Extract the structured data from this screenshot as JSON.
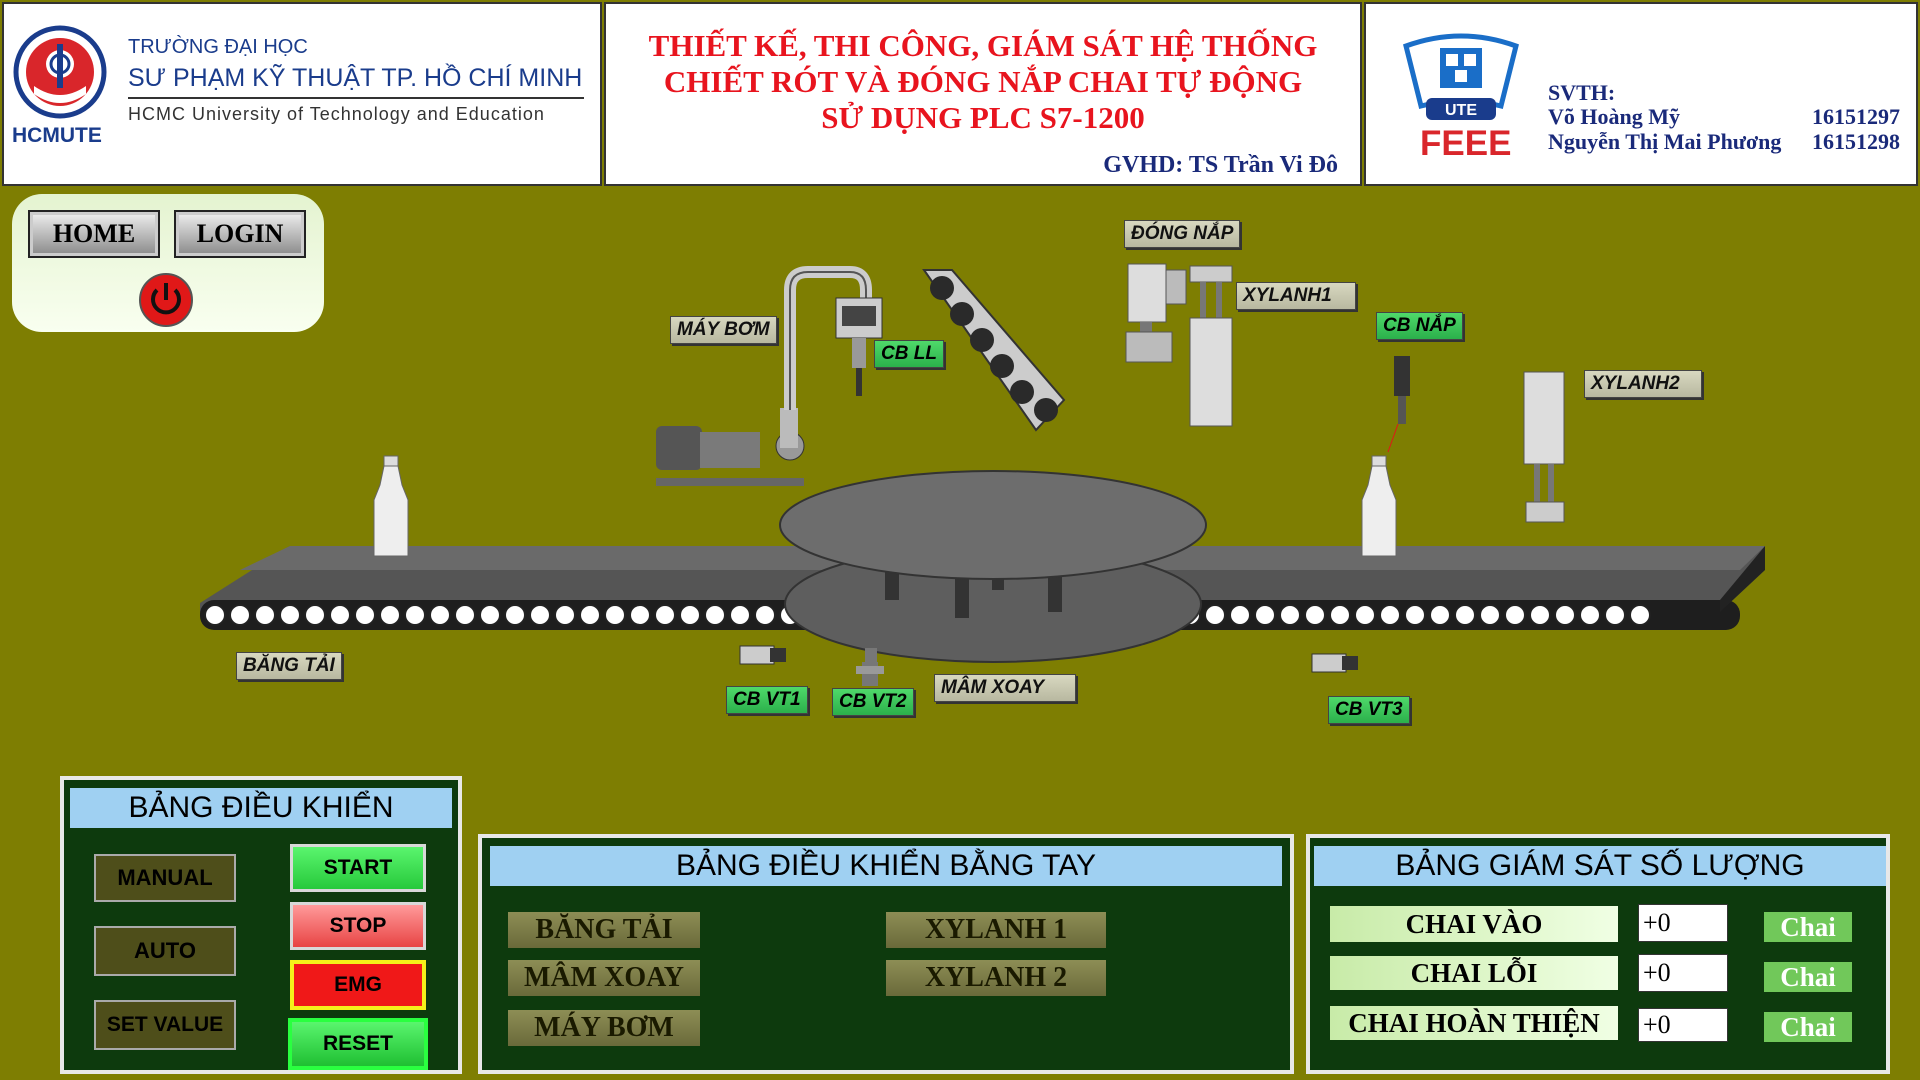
{
  "header": {
    "school": {
      "line1": "TRƯỜNG ĐẠI HỌC",
      "line2": "SƯ PHẠM KỸ THUẬT TP. HỒ CHÍ MINH",
      "line3": "HCMC University of Technology and Education",
      "logo_text": "HCMUTE"
    },
    "title": {
      "line1": "THIẾT KẾ, THI CÔNG, GIÁM SÁT HỆ THỐNG",
      "line2": "CHIẾT RÓT VÀ ĐÓNG NẮP CHAI TỰ ĐỘNG",
      "line3": "SỬ DỤNG PLC S7-1200",
      "advisor": "GVHD: TS Trần Vi Đô"
    },
    "students": {
      "logo_ute": "UTE",
      "logo_feee": "FEEE",
      "label": "SVTH:",
      "list": [
        {
          "name": "Võ Hoàng Mỹ",
          "id": "16151297"
        },
        {
          "name": "Nguyễn Thị Mai Phương",
          "id": "16151298"
        }
      ]
    }
  },
  "nav": {
    "home": "HOME",
    "login": "LOGIN"
  },
  "scene": {
    "may_bom": "MÁY BƠM",
    "cb_ll": "CB LL",
    "dong_nap": "ĐÓNG NẮP",
    "xylanh1": "XYLANH1",
    "cb_nap": "CB NẮP",
    "xylanh2": "XYLANH2",
    "bang_tai": "BĂNG TẢI",
    "cb_vt1": "CB VT1",
    "cb_vt2": "CB VT2",
    "mam_xoay": "MÂM XOAY",
    "cb_vt3": "CB VT3"
  },
  "control_panel": {
    "title": "BẢNG ĐIỀU KHIỂN",
    "manual": "MANUAL",
    "auto": "AUTO",
    "set_value": "SET VALUE",
    "start": "START",
    "stop": "STOP",
    "emg": "EMG",
    "reset": "RESET"
  },
  "manual_panel": {
    "title": "BẢNG ĐIỀU KHIỂN BẰNG TAY",
    "bang_tai": "BĂNG TẢI",
    "mam_xoay": "MÂM XOAY",
    "may_bom": "MÁY BƠM",
    "xylanh1": "XYLANH 1",
    "xylanh2": "XYLANH 2"
  },
  "monitor_panel": {
    "title": "BẢNG GIÁM SÁT SỐ LƯỢNG",
    "rows": [
      {
        "label": "CHAI VÀO",
        "value": "+0",
        "unit": "Chai"
      },
      {
        "label": "CHAI LỖI",
        "value": "+0",
        "unit": "Chai"
      },
      {
        "label": "CHAI HOÀN THIỆN",
        "value": "+0",
        "unit": "Chai"
      }
    ]
  }
}
